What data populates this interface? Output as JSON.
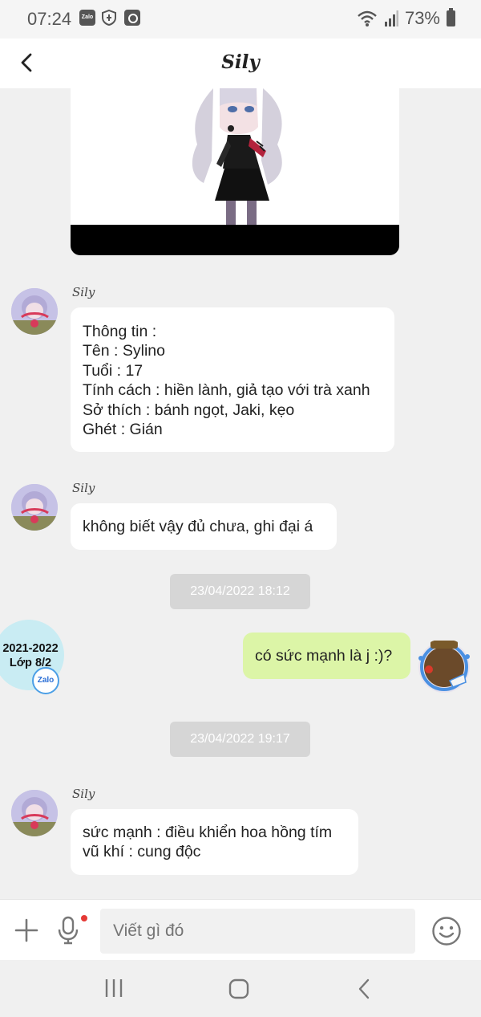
{
  "status_bar": {
    "time": "07:24",
    "battery": "73%",
    "zalo_icon_text": "Zalo",
    "icons": [
      "zalo-icon",
      "shield-icon",
      "clock-icon",
      "wifi-icon",
      "signal-icon",
      "battery-icon"
    ]
  },
  "header": {
    "title": "Sily",
    "back_icon": "chevron-left-icon"
  },
  "messages": [
    {
      "sender": "Sily",
      "lines": [
        "Thông tin :",
        "Tên : Sylino",
        "Tuổi : 17",
        "Tính cách : hiền lành, giả tạo với trà xanh",
        "Sở thích : bánh ngọt, Jaki, kẹo",
        "Ghét : Gián"
      ]
    },
    {
      "sender": "Sily",
      "lines": [
        "không biết vậy đủ chưa, ghi đại á"
      ]
    },
    {
      "timestamp": "23/04/2022 18:12"
    },
    {
      "mine": true,
      "lines": [
        "có sức mạnh là j :)?"
      ]
    },
    {
      "timestamp": "23/04/2022 19:17"
    },
    {
      "sender": "Sily",
      "lines": [
        "sức mạnh : điều khiển hoa hồng tím",
        "vũ khí : cung độc"
      ]
    }
  ],
  "class_bubble": {
    "line1": "2021-2022",
    "line2": "Lớp 8/2",
    "badge": "Zalo"
  },
  "input": {
    "placeholder": "Viết gì đó"
  },
  "colors": {
    "my_bubble": "#dcf5a7",
    "other_bubble": "#ffffff",
    "background": "#f0f0f0",
    "timestamp_bg": "#d6d6d6"
  }
}
